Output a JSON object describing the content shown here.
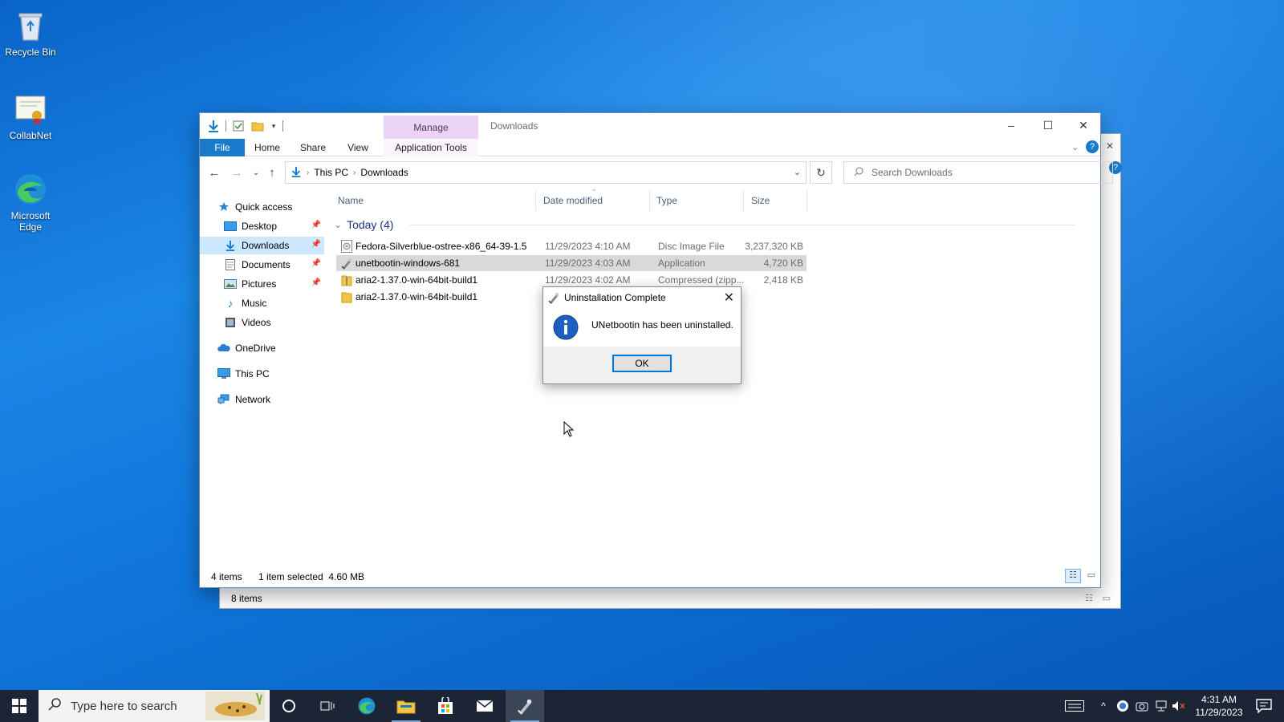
{
  "desktop": {
    "icons": [
      {
        "label": "Recycle Bin",
        "icon": "recycle-bin-icon"
      },
      {
        "label": "CollabNet",
        "icon": "certificate-icon"
      },
      {
        "label": "Microsoft Edge",
        "icon": "edge-icon"
      }
    ]
  },
  "back_window": {
    "status": "8 items"
  },
  "explorer": {
    "context_tab": "Manage",
    "title": "Downloads",
    "tabs": {
      "file": "File",
      "home": "Home",
      "share": "Share",
      "view": "View",
      "app_tools": "Application Tools"
    },
    "breadcrumb": [
      "This PC",
      "Downloads"
    ],
    "search_placeholder": "Search Downloads",
    "nav": {
      "quick_access": "Quick access",
      "desktop": "Desktop",
      "downloads": "Downloads",
      "documents": "Documents",
      "pictures": "Pictures",
      "music": "Music",
      "videos": "Videos",
      "onedrive": "OneDrive",
      "this_pc": "This PC",
      "network": "Network"
    },
    "columns": {
      "name": "Name",
      "date": "Date modified",
      "type": "Type",
      "size": "Size"
    },
    "group": "Today (4)",
    "files": [
      {
        "name": "Fedora-Silverblue-ostree-x86_64-39-1.5",
        "date": "11/29/2023 4:10 AM",
        "type": "Disc Image File",
        "size": "3,237,320 KB",
        "icon": "disc-image-icon"
      },
      {
        "name": "unetbootin-windows-681",
        "date": "11/29/2023 4:03 AM",
        "type": "Application",
        "size": "4,720 KB",
        "icon": "unetbootin-app-icon",
        "selected": true
      },
      {
        "name": "aria2-1.37.0-win-64bit-build1",
        "date": "11/29/2023 4:02 AM",
        "type": "Compressed (zipp...",
        "size": "2,418 KB",
        "icon": "zip-folder-icon"
      },
      {
        "name": "aria2-1.37.0-win-64bit-build1",
        "date": "",
        "type": "",
        "size": "",
        "icon": "folder-icon"
      }
    ],
    "status_items": "4 items",
    "status_selected": "1 item selected  4.60 MB"
  },
  "dialog": {
    "title": "Uninstallation Complete",
    "message": "UNetbootin has been uninstalled.",
    "ok": "OK"
  },
  "taskbar": {
    "search_placeholder": "Type here to search",
    "time": "4:31 AM",
    "date": "11/29/2023"
  },
  "colors": {
    "accent": "#0078d7",
    "file_tab": "#1979ca",
    "manage_tab": "#ecd4f6",
    "selection": "#cce8ff",
    "taskbar": "#1b2535"
  }
}
